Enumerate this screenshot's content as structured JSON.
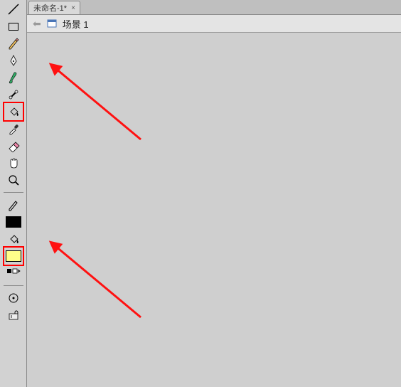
{
  "tab": {
    "title": "未命名-1*"
  },
  "scene": {
    "label": "场景 1"
  },
  "colors": {
    "stroke": "#000000",
    "fill": "#fffe8a",
    "highlight": "#ff0000"
  },
  "tools": [
    {
      "id": "line",
      "name": "line-tool"
    },
    {
      "id": "rectangle",
      "name": "rectangle-tool"
    },
    {
      "id": "pencil",
      "name": "pencil-tool"
    },
    {
      "id": "pen",
      "name": "pen-tool"
    },
    {
      "id": "brush",
      "name": "brush-tool"
    },
    {
      "id": "bone",
      "name": "bone-tool"
    },
    {
      "id": "paint-bucket",
      "name": "paint-bucket-tool",
      "highlighted": true
    },
    {
      "id": "eyedropper",
      "name": "eyedropper-tool"
    },
    {
      "id": "eraser",
      "name": "eraser-tool"
    },
    {
      "id": "hand",
      "name": "hand-tool"
    },
    {
      "id": "zoom",
      "name": "zoom-tool"
    }
  ]
}
